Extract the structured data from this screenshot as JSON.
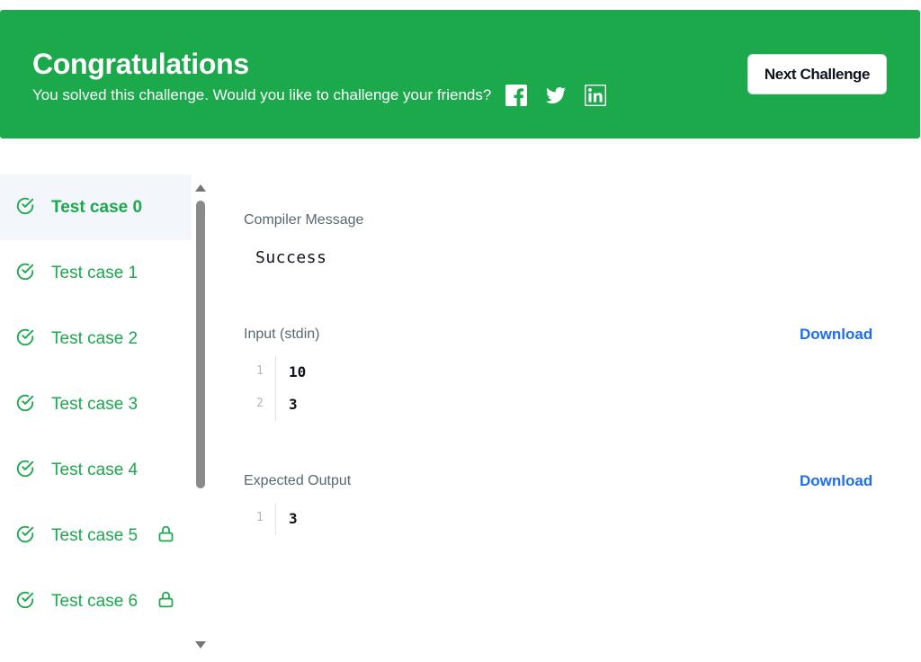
{
  "banner": {
    "title": "Congratulations",
    "subtitle": "You solved this challenge. Would you like to challenge your friends?",
    "social_icons": [
      "facebook-icon",
      "twitter-icon",
      "linkedin-icon"
    ],
    "next_button": "Next Challenge",
    "color": "#1ba94c"
  },
  "sidebar": {
    "test_cases": [
      {
        "label": "Test case 0",
        "status": "passed",
        "locked": false,
        "active": true
      },
      {
        "label": "Test case 1",
        "status": "passed",
        "locked": false,
        "active": false
      },
      {
        "label": "Test case 2",
        "status": "passed",
        "locked": false,
        "active": false
      },
      {
        "label": "Test case 3",
        "status": "passed",
        "locked": false,
        "active": false
      },
      {
        "label": "Test case 4",
        "status": "passed",
        "locked": false,
        "active": false
      },
      {
        "label": "Test case 5",
        "status": "passed",
        "locked": true,
        "active": false
      },
      {
        "label": "Test case 6",
        "status": "passed",
        "locked": true,
        "active": false
      }
    ],
    "pass_color": "#1ba94c"
  },
  "result": {
    "compiler_label": "Compiler Message",
    "compiler_message": "Success",
    "input_label": "Input (stdin)",
    "input_download": "Download",
    "input_lines": [
      {
        "num": "1",
        "text": "10"
      },
      {
        "num": "2",
        "text": "3"
      }
    ],
    "expected_label": "Expected Output",
    "expected_download": "Download",
    "expected_lines": [
      {
        "num": "1",
        "text": "3"
      }
    ],
    "link_color": "#1f6ef0"
  }
}
